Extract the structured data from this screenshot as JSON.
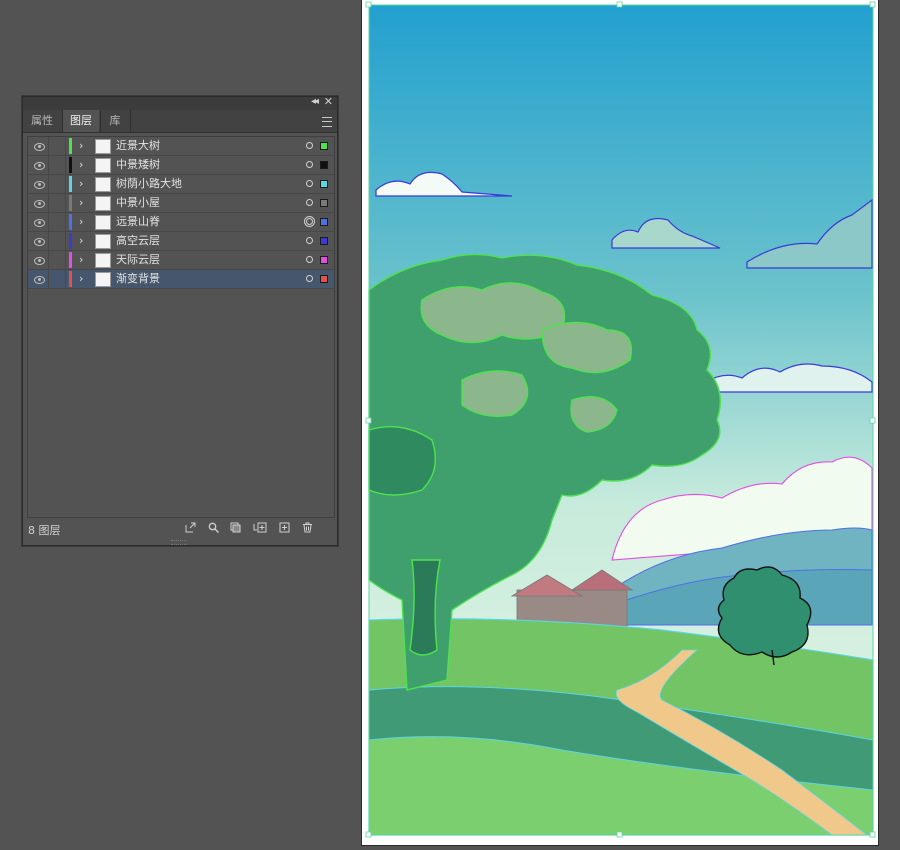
{
  "panel": {
    "collapse_icon": "double-chevron-left",
    "close_icon": "close-x",
    "tabs": [
      {
        "label": "属性"
      },
      {
        "label": "图层"
      },
      {
        "label": "库"
      }
    ],
    "active_tab": "图层",
    "menu_icon": "hamburger-menu",
    "layers": [
      {
        "name": "近景大树",
        "color": "#4ee34e",
        "swatch": "#4ee34e",
        "target": "circle"
      },
      {
        "name": "中景矮树",
        "color": "#111111",
        "swatch": "#111111",
        "target": "circle"
      },
      {
        "name": "树荫小路大地",
        "color": "#5ad6e6",
        "swatch": "#5ad6e6",
        "target": "circle"
      },
      {
        "name": "中景小屋",
        "color": "#7a7a7a",
        "swatch": "#7a7a7a",
        "target": "circle"
      },
      {
        "name": "远景山脊",
        "color": "#4f6fe6",
        "swatch": "#4f6fe6",
        "target": "double-circle"
      },
      {
        "name": "高空云层",
        "color": "#3a3ad6",
        "swatch": "#3a3ad6",
        "target": "circle"
      },
      {
        "name": "天际云层",
        "color": "#e24ee2",
        "swatch": "#e24ee2",
        "target": "circle"
      },
      {
        "name": "渐变背景",
        "color": "#e25050",
        "swatch": "#e25050",
        "target": "circle",
        "selected": true
      }
    ],
    "footer": {
      "count_label": "8 图层",
      "icons": [
        "export-icon",
        "search-icon",
        "clip-mask-icon",
        "new-sublayer-icon",
        "new-layer-icon",
        "trash-icon"
      ]
    }
  },
  "colors": {
    "ui_background": "#535353",
    "selection": "#46566c",
    "sky_top": "#2aa3cf",
    "sky_bottom": "#cfeee0",
    "foliage": "#3f9a6a",
    "grass": "#7fcf6a",
    "path": "#f0c98a"
  }
}
